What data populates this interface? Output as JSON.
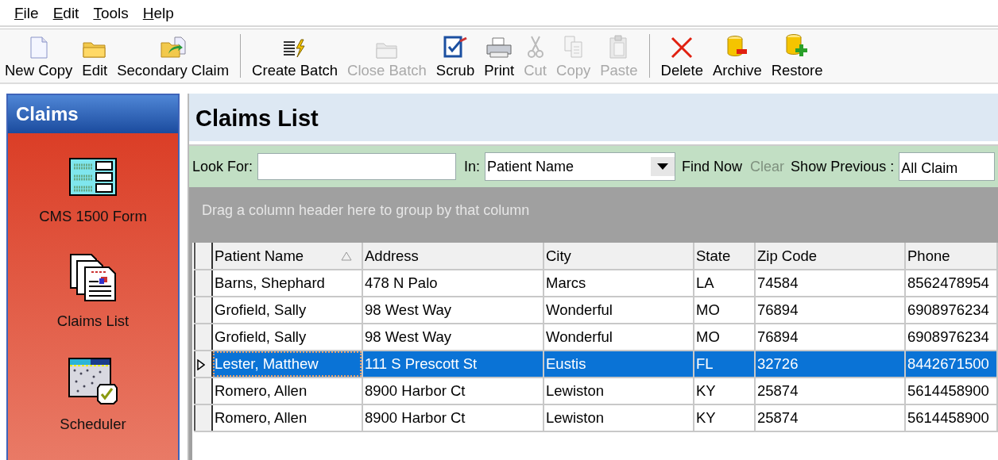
{
  "menu": [
    {
      "label": "File"
    },
    {
      "label": "Edit"
    },
    {
      "label": "Tools"
    },
    {
      "label": "Help"
    }
  ],
  "toolbar": {
    "groups": [
      [
        {
          "label": "New Copy",
          "disabled": false
        },
        {
          "label": "Edit",
          "disabled": false
        },
        {
          "label": "Secondary Claim",
          "disabled": false
        }
      ],
      [
        {
          "label": "Create Batch",
          "disabled": false
        },
        {
          "label": "Close Batch",
          "disabled": true
        },
        {
          "label": "Scrub",
          "disabled": false
        },
        {
          "label": "Print",
          "disabled": false
        },
        {
          "label": "Cut",
          "disabled": true
        },
        {
          "label": "Copy",
          "disabled": true
        },
        {
          "label": "Paste",
          "disabled": true
        }
      ],
      [
        {
          "label": "Delete",
          "disabled": false
        },
        {
          "label": "Archive",
          "disabled": false
        },
        {
          "label": "Restore",
          "disabled": false
        }
      ]
    ]
  },
  "sidebar": {
    "title": "Claims",
    "items": [
      {
        "label": "CMS 1500 Form"
      },
      {
        "label": "Claims List"
      },
      {
        "label": "Scheduler"
      }
    ]
  },
  "content": {
    "title": "Claims List",
    "search": {
      "look_for_label": "Look For:",
      "in_label": "In:",
      "in_value": "Patient Name",
      "find_now": "Find Now",
      "clear": {
        "label": "Clear",
        "disabled": true
      },
      "show_previous_label": "Show Previous :",
      "show_previous_value": "All Claim"
    },
    "group_hint": "Drag a column header here to group by that column",
    "table": {
      "columns": [
        {
          "label": "Patient Name",
          "sorted": true
        },
        {
          "label": "Address",
          "sorted": false
        },
        {
          "label": "City",
          "sorted": false
        },
        {
          "label": "State",
          "sorted": false
        },
        {
          "label": "Zip Code",
          "sorted": false
        },
        {
          "label": "Phone",
          "sorted": false
        }
      ],
      "rows": [
        {
          "selected": false,
          "cells": [
            "Barns, Shephard",
            "478 N Palo",
            "Marcs",
            "LA",
            "74584",
            "8562478954"
          ]
        },
        {
          "selected": false,
          "cells": [
            "Grofield, Sally",
            "98 West Way",
            "Wonderful",
            "MO",
            "76894",
            "6908976234"
          ]
        },
        {
          "selected": false,
          "cells": [
            "Grofield, Sally",
            "98 West Way",
            "Wonderful",
            "MO",
            "76894",
            "6908976234"
          ]
        },
        {
          "selected": true,
          "cells": [
            "Lester, Matthew",
            "111 S Prescott St",
            "Eustis",
            "FL",
            "32726",
            "8442671500"
          ]
        },
        {
          "selected": false,
          "cells": [
            "Romero, Allen",
            "8900 Harbor Ct",
            "Lewiston",
            "KY",
            "25874",
            "5614458900"
          ]
        },
        {
          "selected": false,
          "cells": [
            "Romero, Allen",
            "8900 Harbor Ct",
            "Lewiston",
            "KY",
            "25874",
            "5614458900"
          ]
        }
      ]
    }
  }
}
